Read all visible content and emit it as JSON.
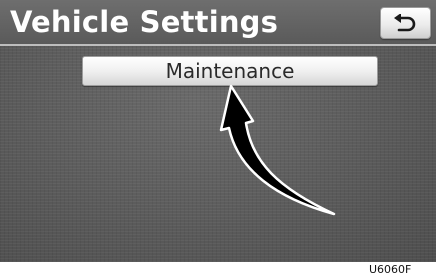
{
  "header": {
    "title": "Vehicle Settings",
    "back_icon": "return-arrow-icon"
  },
  "main": {
    "maintenance_label": "Maintenance"
  },
  "annotation": {
    "pointer_icon": "curved-pointer-arrow-icon",
    "figure_code": "U6060F"
  },
  "colors": {
    "screen_background": "#5b5b5b",
    "title_text": "#ffffff",
    "button_face": "#f0f0f0",
    "button_text": "#2a2a2a",
    "arrow": "#000000"
  }
}
